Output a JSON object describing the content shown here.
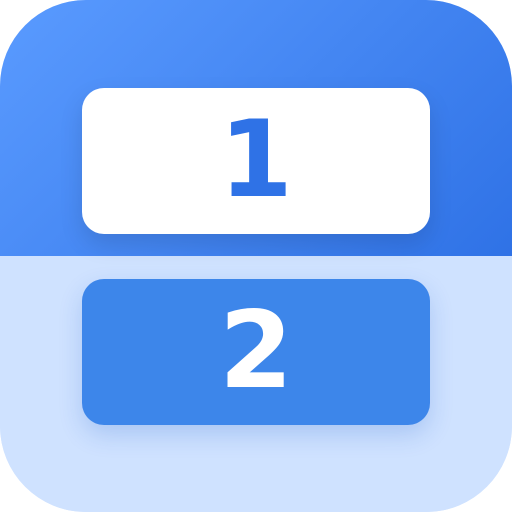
{
  "icon": {
    "top_digit": "1",
    "bottom_digit": "2"
  },
  "colors": {
    "top_gradient_start": "#5a9bff",
    "top_gradient_end": "#2f72e6",
    "bottom_background": "#cfe2ff",
    "top_card_background": "#ffffff",
    "top_card_text": "#2f72e6",
    "bottom_card_background": "#3d86ea",
    "bottom_card_text": "#ffffff"
  }
}
